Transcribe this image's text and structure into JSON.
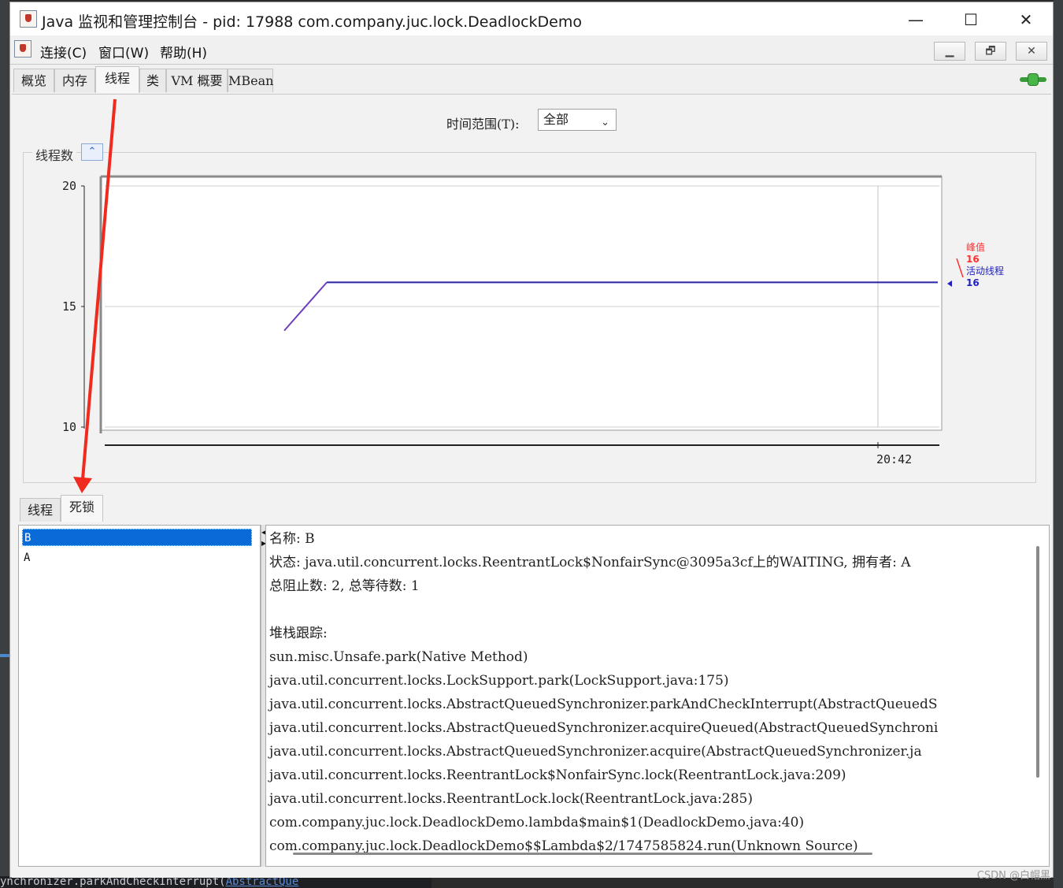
{
  "window": {
    "title": "Java 监视和管理控制台 - pid: 17988 com.company.juc.lock.DeadlockDemo",
    "controls": {
      "minimize": "—",
      "maximize": "☐",
      "close": "✕"
    }
  },
  "menubar": {
    "items": [
      "连接(C)",
      "窗口(W)",
      "帮助(H)"
    ],
    "mdi_controls": {
      "minimize": "▁",
      "restore": "🗗",
      "close": "✕"
    }
  },
  "tabs": [
    {
      "label": "概览"
    },
    {
      "label": "内存"
    },
    {
      "label": "线程",
      "active": true
    },
    {
      "label": "类"
    },
    {
      "label": "VM 概要"
    },
    {
      "label": "MBean"
    }
  ],
  "time_range": {
    "label": "时间范围(T):",
    "value": "全部"
  },
  "chart_panel": {
    "title": "线程数",
    "collapse_icon": "chevrons-up-icon"
  },
  "chart_data": {
    "type": "line",
    "title": "线程数",
    "y_ticks": [
      "20",
      "15",
      "10"
    ],
    "ylim": [
      10,
      20
    ],
    "x_ticks": [
      "20:42"
    ],
    "series": [
      {
        "name": "峰值",
        "color": "#ff3030",
        "current": "16"
      },
      {
        "name": "活动线程",
        "color": "#2020c0",
        "current": "16"
      }
    ],
    "points": [
      [
        0,
        14
      ],
      [
        1,
        16
      ],
      [
        2,
        16
      ],
      [
        3,
        16
      ]
    ],
    "grid": true
  },
  "legend": {
    "peak_label": "峰值",
    "peak_value": "16",
    "live_label": "活动线程",
    "live_value": "16"
  },
  "bottom_tabs": [
    {
      "label": "线程"
    },
    {
      "label": "死锁",
      "active": true
    }
  ],
  "deadlock_threads": [
    {
      "name": "B",
      "selected": true
    },
    {
      "name": "A",
      "selected": false
    }
  ],
  "detail": {
    "lines": [
      "名称: B",
      "状态: java.util.concurrent.locks.ReentrantLock$NonfairSync@3095a3cf上的WAITING, 拥有者: A",
      "总阻止数: 2, 总等待数: 1",
      "",
      "堆栈跟踪:",
      "sun.misc.Unsafe.park(Native Method)",
      "java.util.concurrent.locks.LockSupport.park(LockSupport.java:175)",
      "java.util.concurrent.locks.AbstractQueuedSynchronizer.parkAndCheckInterrupt(AbstractQueuedS",
      "java.util.concurrent.locks.AbstractQueuedSynchronizer.acquireQueued(AbstractQueuedSynchroni",
      "java.util.concurrent.locks.AbstractQueuedSynchronizer.acquire(AbstractQueuedSynchronizer.ja",
      "java.util.concurrent.locks.ReentrantLock$NonfairSync.lock(ReentrantLock.java:209)",
      "java.util.concurrent.locks.ReentrantLock.lock(ReentrantLock.java:285)",
      "com.company.juc.lock.DeadlockDemo.lambda$main$1(DeadlockDemo.java:40)",
      "com.company.juc.lock.DeadlockDemo$$Lambda$2/1747585824.run(Unknown Source)"
    ]
  },
  "background_code": {
    "text": "ynchronizer.parkAndCheckInterrupt(",
    "link": "AbstractQue"
  },
  "watermark": "CSDN @白帽黑"
}
